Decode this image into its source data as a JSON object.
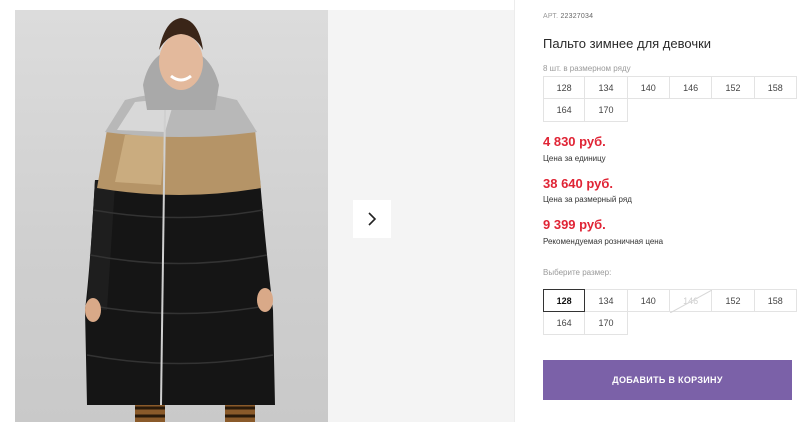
{
  "product": {
    "sku_label": "АРТ.",
    "sku": "22327034",
    "title": "Пальто зимнее для девочки"
  },
  "pack": {
    "label": "8 шт. в размерном ряду",
    "sizes": [
      "128",
      "134",
      "140",
      "146",
      "152",
      "158",
      "164",
      "170"
    ]
  },
  "prices": {
    "unit_price": "4 830 руб.",
    "unit_caption": "Цена за единицу",
    "pack_price": "38 640 руб.",
    "pack_caption": "Цена за размерный ряд",
    "retail_price": "9 399 руб.",
    "retail_caption": "Рекомендуемая розничная цена"
  },
  "size_select": {
    "label": "Выберите размер:",
    "sizes": [
      "128",
      "134",
      "140",
      "146",
      "152",
      "158",
      "164",
      "170"
    ],
    "selected": "128",
    "unavailable": [
      "146"
    ]
  },
  "cart_button_label": "ДОБАВИТЬ В КОРЗИНУ",
  "colors": {
    "accent": "#7b61a8",
    "price": "#e02435"
  },
  "icons": {
    "next": "chevron-right-icon"
  }
}
